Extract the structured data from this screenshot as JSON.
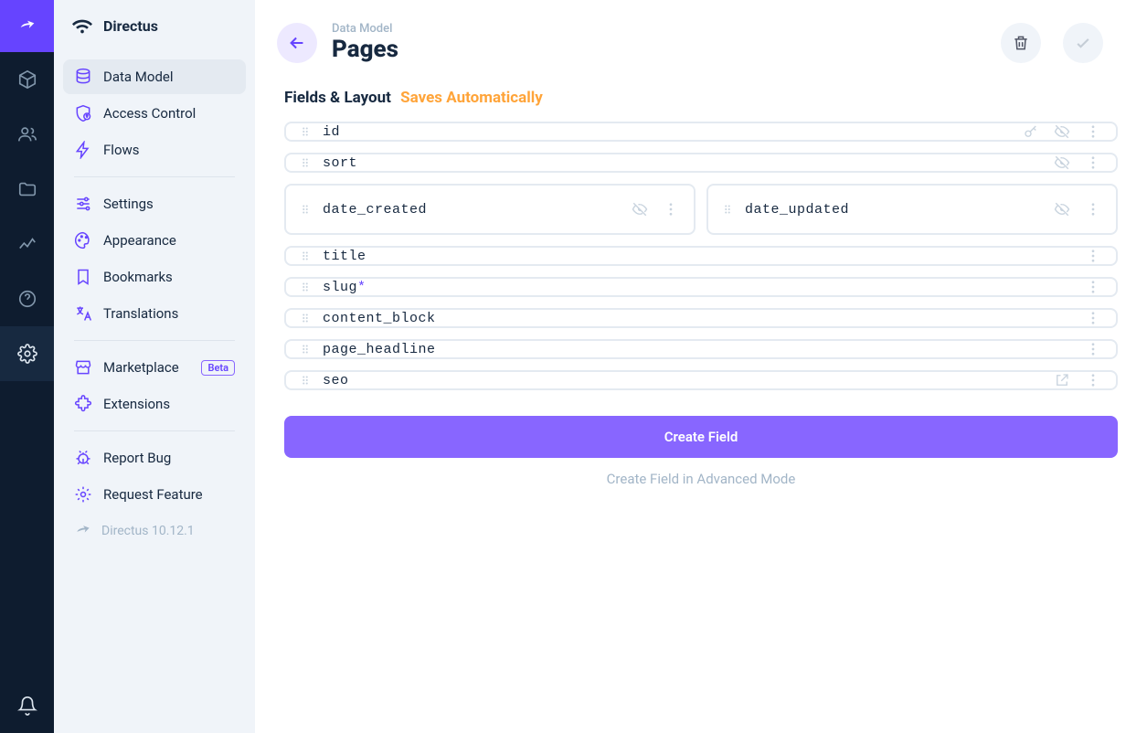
{
  "rail": {
    "items": [
      "content",
      "users",
      "files",
      "insights",
      "help",
      "settings"
    ]
  },
  "side": {
    "project_name": "Directus",
    "items": [
      {
        "label": "Data Model",
        "icon": "database",
        "active": true
      },
      {
        "label": "Access Control",
        "icon": "shield"
      },
      {
        "label": "Flows",
        "icon": "bolt"
      }
    ],
    "items2": [
      {
        "label": "Settings",
        "icon": "sliders"
      },
      {
        "label": "Appearance",
        "icon": "palette"
      },
      {
        "label": "Bookmarks",
        "icon": "bookmark"
      },
      {
        "label": "Translations",
        "icon": "translate"
      }
    ],
    "items3": [
      {
        "label": "Marketplace",
        "icon": "store",
        "badge": "Beta"
      },
      {
        "label": "Extensions",
        "icon": "extension"
      }
    ],
    "items4": [
      {
        "label": "Report Bug",
        "icon": "bug"
      },
      {
        "label": "Request Feature",
        "icon": "feature"
      }
    ],
    "version": "Directus 10.12.1"
  },
  "header": {
    "breadcrumb": "Data Model",
    "title": "Pages"
  },
  "section": {
    "title": "Fields & Layout",
    "auto_save": "Saves Automatically"
  },
  "fields": [
    {
      "name": "id",
      "width": "full",
      "icons": [
        "key",
        "hidden",
        "more"
      ]
    },
    {
      "name": "sort",
      "width": "full",
      "icons": [
        "hidden",
        "more"
      ]
    },
    {
      "name": "date_created",
      "width": "half",
      "icons": [
        "hidden",
        "more"
      ]
    },
    {
      "name": "date_updated",
      "width": "half",
      "icons": [
        "hidden",
        "more"
      ]
    },
    {
      "name": "title",
      "width": "full",
      "icons": [
        "more"
      ]
    },
    {
      "name": "slug",
      "required": true,
      "width": "full",
      "icons": [
        "more"
      ]
    },
    {
      "name": "content_block",
      "width": "full",
      "icons": [
        "more"
      ]
    },
    {
      "name": "page_headline",
      "width": "full",
      "icons": [
        "more"
      ]
    },
    {
      "name": "seo",
      "width": "full",
      "icons": [
        "open",
        "more"
      ]
    }
  ],
  "buttons": {
    "create": "Create Field",
    "advanced": "Create Field in Advanced Mode"
  }
}
